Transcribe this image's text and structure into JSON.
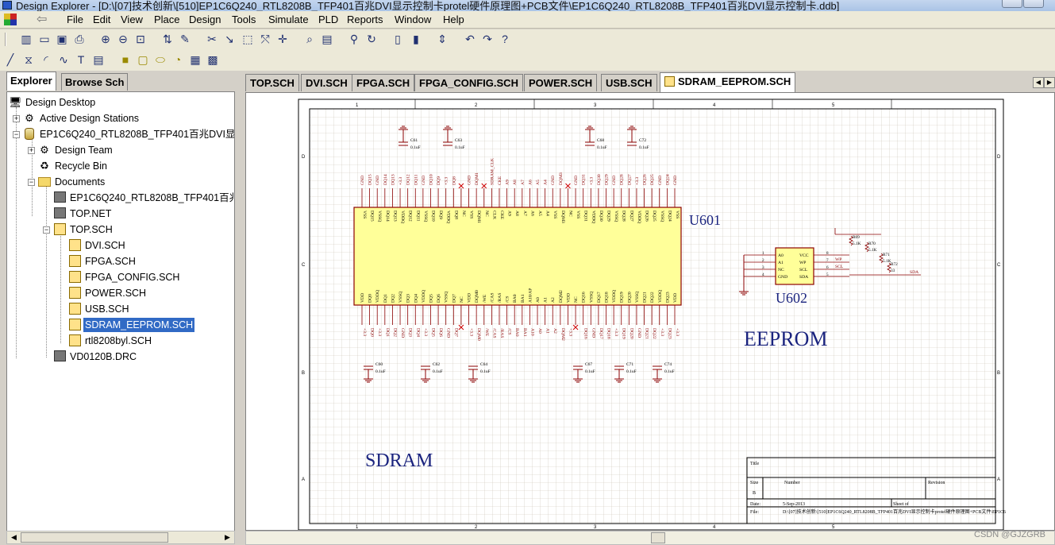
{
  "window": {
    "title": "Design Explorer - [D:\\[07]技术创新\\[510]EP1C6Q240_RTL8208B_TFP401百兆DVI显示控制卡protel硬件原理图+PCB文件\\EP1C6Q240_RTL8208B_TFP401百兆DVI显示控制卡.ddb]"
  },
  "menu": {
    "items": [
      "File",
      "Edit",
      "View",
      "Place",
      "Design",
      "Tools",
      "Simulate",
      "PLD",
      "Reports",
      "Window",
      "Help"
    ]
  },
  "left_panel": {
    "tabs": [
      "Explorer",
      "Browse Sch"
    ],
    "active_tab": "Explorer",
    "tree": [
      {
        "label": "Design Desktop",
        "icon": "desktop-icon",
        "level": 0
      },
      {
        "label": "Active Design Stations",
        "icon": "stations-icon",
        "level": 1,
        "expander": "+"
      },
      {
        "label": "EP1C6Q240_RTL8208B_TFP401百兆DVI显示",
        "icon": "database-icon",
        "level": 1,
        "expander": "-"
      },
      {
        "label": "Design Team",
        "icon": "team-icon",
        "level": 2,
        "expander": "+"
      },
      {
        "label": "Recycle Bin",
        "icon": "recycle-bin-icon",
        "level": 2
      },
      {
        "label": "Documents",
        "icon": "folder-icon",
        "level": 2,
        "expander": "-"
      },
      {
        "label": "EP1C6Q240_RTL8208B_TFP401百兆",
        "icon": "pcb-icon",
        "level": 3
      },
      {
        "label": "TOP.NET",
        "icon": "netlist-icon",
        "level": 3
      },
      {
        "label": "TOP.SCH",
        "icon": "schematic-icon",
        "level": 3,
        "expander": "-"
      },
      {
        "label": "DVI.SCH",
        "icon": "schematic-icon",
        "level": 4
      },
      {
        "label": "FPGA.SCH",
        "icon": "schematic-icon",
        "level": 4
      },
      {
        "label": "FPGA_CONFIG.SCH",
        "icon": "schematic-icon",
        "level": 4
      },
      {
        "label": "POWER.SCH",
        "icon": "schematic-icon",
        "level": 4
      },
      {
        "label": "USB.SCH",
        "icon": "schematic-icon",
        "level": 4
      },
      {
        "label": "SDRAM_EEPROM.SCH",
        "icon": "schematic-icon",
        "level": 4,
        "selected": true
      },
      {
        "label": "rtl8208byl.SCH",
        "icon": "schematic-icon",
        "level": 4
      },
      {
        "label": "VD0120B.DRC",
        "icon": "drc-icon",
        "level": 3
      }
    ]
  },
  "doc_tabs": [
    "TOP.SCH",
    "DVI.SCH",
    "FPGA.SCH",
    "FPGA_CONFIG.SCH",
    "POWER.SCH",
    "USB.SCH",
    "SDRAM_EEPROM.SCH"
  ],
  "active_doc_tab": "SDRAM_EEPROM.SCH",
  "schematic": {
    "border_cols": [
      "1",
      "2",
      "3",
      "4",
      "5"
    ],
    "border_rows": [
      "D",
      "C",
      "B",
      "A"
    ],
    "labels": {
      "sdram": "SDRAM",
      "eeprom": "EEPROM",
      "u601": "U601",
      "u602": "U602"
    },
    "capacitors_top": [
      {
        "ref": "C61",
        "value": "0.1uF"
      },
      {
        "ref": "C63",
        "value": "0.1uF"
      },
      {
        "ref": "C68",
        "value": "0.1uF"
      },
      {
        "ref": "C72",
        "value": "0.1uF"
      }
    ],
    "capacitors_bottom": [
      {
        "ref": "C60",
        "value": "0.1uF"
      },
      {
        "ref": "C62",
        "value": "0.1uF"
      },
      {
        "ref": "C64",
        "value": "0.1uF"
      },
      {
        "ref": "C67",
        "value": "0.1uF"
      },
      {
        "ref": "C71",
        "value": "0.1uF"
      },
      {
        "ref": "C74",
        "value": "0.1uF"
      }
    ],
    "u601_top_pins": [
      "VSS",
      "DQ15",
      "VSSQ",
      "DQ14",
      "DQ13",
      "VDDQ",
      "DQ12",
      "DQ11",
      "VSSQ",
      "DQ10",
      "DQ9",
      "VDDQ",
      "DQ8",
      "NC",
      "VSS",
      "DQM1",
      "NC",
      "CLK",
      "CKE",
      "A9",
      "A8",
      "A7",
      "A6",
      "A5",
      "A4",
      "VSS",
      "DQM3",
      "NC",
      "VSS",
      "DQ31",
      "VDDQ",
      "DQ30",
      "DQ29",
      "VSSQ",
      "DQ28",
      "DQ27",
      "VDDQ",
      "DQ26",
      "DQ25",
      "VSSQ",
      "DQ24",
      "VSS"
    ],
    "u601_bottom_pins": [
      "VDD",
      "DQ0",
      "VDDQ",
      "DQ1",
      "DQ2",
      "VSSQ",
      "DQ3",
      "DQ4",
      "VDDQ",
      "DQ5",
      "DQ6",
      "VSSQ",
      "DQ7",
      "NC",
      "VDD",
      "DQM0",
      "/WE",
      "/CAS",
      "/RAS",
      "/CS",
      "BA0",
      "BA1",
      "A10/AP",
      "A0",
      "A1",
      "A2",
      "DQM2",
      "VDD",
      "NC",
      "DQ16",
      "VSSQ",
      "DQ17",
      "DQ18",
      "VDDQ",
      "DQ19",
      "DQ20",
      "VSSQ",
      "DQ21",
      "DQ22",
      "VDDQ",
      "DQ23",
      "VDD"
    ],
    "u601_top_nets": [
      "GND",
      "DQ15",
      "GND",
      "DQ14",
      "DQ13",
      "+3.3",
      "DQ12",
      "DQ11",
      "GND",
      "DQ10",
      "DQ9",
      "+3.3",
      "DQ8",
      "",
      "GND",
      "DQM1",
      "",
      "SDRAM_CLK",
      "CKE",
      "A9",
      "A8",
      "A7",
      "A6",
      "A5",
      "A4",
      "GND",
      "DQM3",
      "",
      "GND",
      "DQ31",
      "+3.3",
      "DQ30",
      "DQ29",
      "GND",
      "DQ28",
      "DQ27",
      "+3.3",
      "DQ26",
      "DQ25",
      "GND",
      "DQ24",
      "GND"
    ],
    "u601_bottom_nets": [
      "+3.3",
      "DQ0",
      "+3.3",
      "DQ1",
      "DQ2",
      "GND",
      "DQ3",
      "DQ4",
      "+3.3",
      "DQ5",
      "DQ6",
      "GND",
      "DQ7",
      "",
      "+3.3",
      "DQM0",
      "/WE",
      "/CAS",
      "/RAS",
      "/CS",
      "BA0",
      "BA1",
      "A10",
      "A0",
      "A1",
      "A2",
      "DQM2",
      "+3.3",
      "",
      "DQ16",
      "GND",
      "DQ17",
      "DQ18",
      "+3.3",
      "DQ19",
      "DQ20",
      "GND",
      "DQ21",
      "DQ22",
      "+3.3",
      "DQ23",
      "+3.3"
    ],
    "u602_left_pins": [
      "A0",
      "A1",
      "NC",
      "GND"
    ],
    "u602_right_pins": [
      "VCC",
      "WP",
      "SCL",
      "SDA"
    ],
    "u602_left_nums": [
      "1",
      "2",
      "3",
      "4"
    ],
    "u602_right_nums": [
      "8",
      "7",
      "6",
      "5"
    ],
    "u602_nets": {
      "wp": "WP",
      "scl": "SCL",
      "sda": "SDA"
    },
    "resistors": [
      {
        "ref": "R69",
        "value": "5.1K"
      },
      {
        "ref": "R70",
        "value": "5.1K"
      },
      {
        "ref": "R71",
        "value": "5.1K"
      },
      {
        "ref": "R72",
        "value": "33"
      }
    ],
    "title_block": {
      "title_label": "Title",
      "size_label": "Size",
      "size_value": "B",
      "number_label": "Number",
      "revision_label": "Revision",
      "date_label": "Date:",
      "date_value": "5-Sep-2013",
      "sheet_label": "Sheet    of",
      "file_label": "File:",
      "file_value": "D:\\[07]技术创新\\[510]EP1C6Q240_RTL8208B_TFP401百兆DVI显示控制卡protel硬件原理图+PCB文件\\EP1C6"
    }
  },
  "watermark": "CSDN @GJZGRB"
}
